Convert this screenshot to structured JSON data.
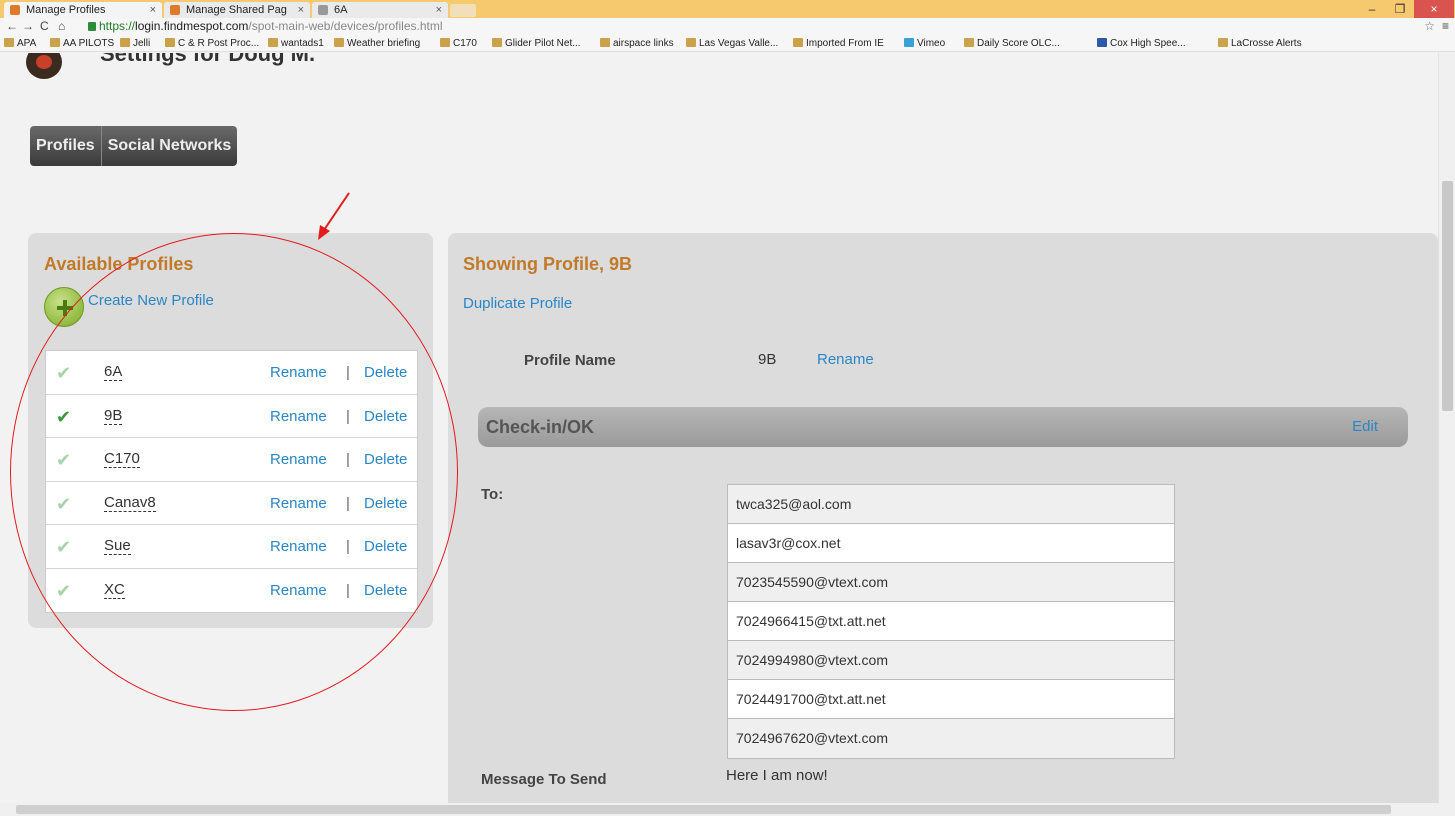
{
  "browser": {
    "tabs": [
      {
        "label": "Manage Profiles"
      },
      {
        "label": "Manage Shared Pag"
      },
      {
        "label": "6A"
      }
    ],
    "url_scheme": "https://",
    "url_host": "login.findmespot.com",
    "url_path": "/spot-main-web/devices/profiles.html",
    "bookmarks": [
      "APA",
      "AA PILOTS",
      "Jelli",
      "C & R Post Proc...",
      "wantads1",
      "Weather briefing",
      "C170",
      "Glider Pilot Net...",
      "airspace links",
      "Las Vegas Valle...",
      "Imported From IE",
      "Vimeo",
      "Daily Score OLC...",
      "Cox High Spee...",
      "LaCrosse Alerts"
    ]
  },
  "header": {
    "title": "Settings for Doug M."
  },
  "nav_tabs": [
    "Profiles",
    "Social Networks"
  ],
  "available": {
    "heading": "Available Profiles",
    "create_label": "Create New Profile",
    "rename_label": "Rename",
    "delete_label": "Delete",
    "separator": "|",
    "profiles": [
      {
        "name": "6A",
        "active": false
      },
      {
        "name": "9B",
        "active": true
      },
      {
        "name": "C170",
        "active": false
      },
      {
        "name": "Canav8",
        "active": false
      },
      {
        "name": "Sue",
        "active": false
      },
      {
        "name": "XC",
        "active": false
      }
    ]
  },
  "detail": {
    "heading": "Showing Profile, 9B",
    "duplicate_label": "Duplicate Profile",
    "profile_name_label": "Profile Name",
    "profile_name_value": "9B",
    "rename_label": "Rename",
    "section_title": "Check-in/OK",
    "edit_label": "Edit",
    "to_label": "To:",
    "recipients": [
      "twca325@aol.com",
      "lasav3r@cox.net",
      "7023545590@vtext.com",
      "7024966415@txt.att.net",
      "7024994980@vtext.com",
      "7024491700@txt.att.net",
      "7024967620@vtext.com"
    ],
    "message_label": "Message To Send",
    "message_value": "Here I am now!"
  },
  "colors": {
    "heading": "#c07a2a",
    "link": "#2a86c6",
    "annotation": "#e31b1b"
  }
}
